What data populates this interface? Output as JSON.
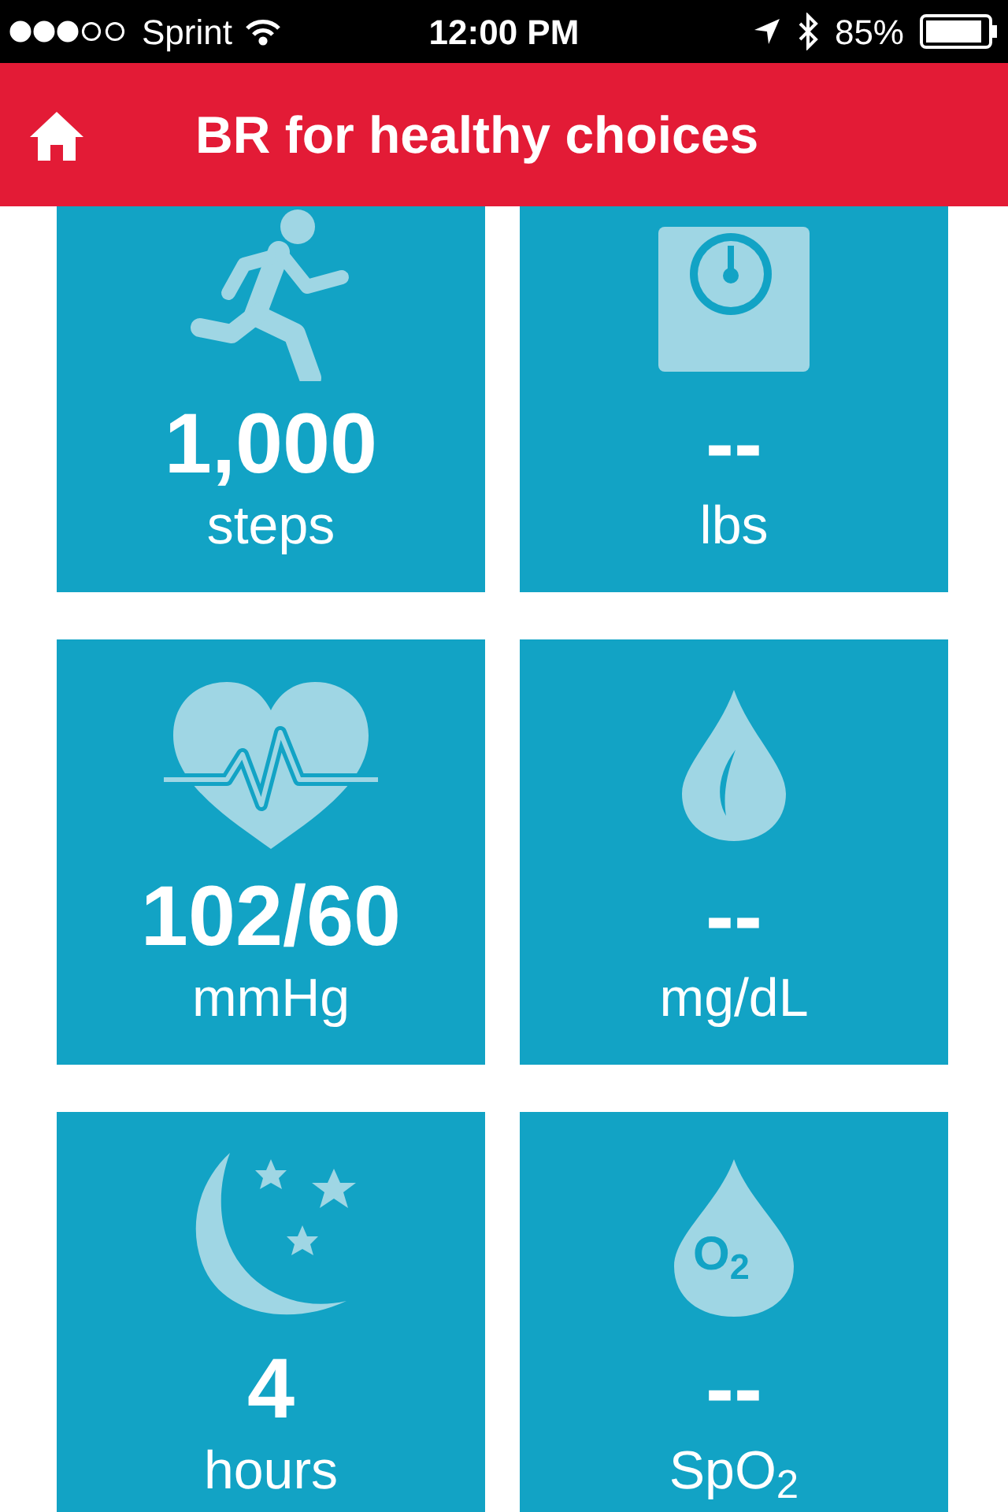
{
  "status_bar": {
    "carrier": "Sprint",
    "time": "12:00 PM",
    "battery": "85%"
  },
  "header": {
    "title": "BR for healthy choices"
  },
  "tiles": [
    {
      "kind": "runner",
      "value": "1,000",
      "unit": "steps"
    },
    {
      "kind": "scale",
      "value": "--",
      "unit": "lbs"
    },
    {
      "kind": "heart",
      "value": "102/60",
      "unit": "mmHg"
    },
    {
      "kind": "drop",
      "value": "--",
      "unit": "mg/dL"
    },
    {
      "kind": "moon",
      "value": "4",
      "unit": "hours"
    },
    {
      "kind": "oxygen",
      "icon_text": "O$_{2}$",
      "value": "--",
      "unit": "SpO$_{2}$"
    }
  ]
}
